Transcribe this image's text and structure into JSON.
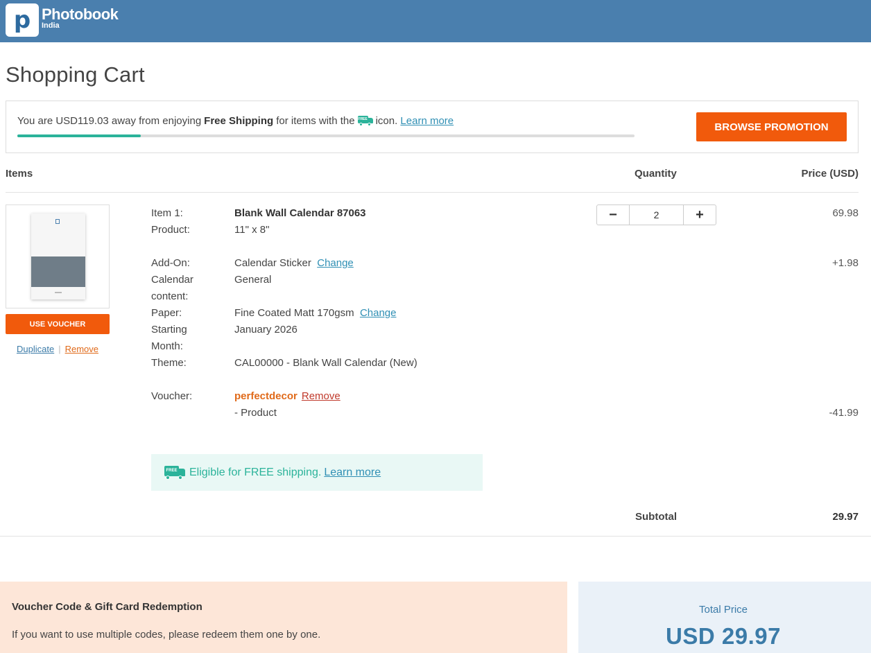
{
  "header": {
    "brand": "Photobook",
    "brand_sub": "India",
    "logo_letter": "p",
    "bg_color": "#4a7fae"
  },
  "page_title": "Shopping Cart",
  "shipping_banner": {
    "prefix": "You are USD119.03 away from enjoying",
    "bold": "Free Shipping",
    "middle": "for items with the",
    "icon_label": "FREE",
    "suffix": "icon.",
    "link": "Learn more",
    "progress_fraction": 0.2,
    "button": "BROWSE PROMOTION"
  },
  "columns": {
    "items": "Items",
    "quantity": "Quantity",
    "price": "Price (USD)"
  },
  "item": {
    "item_label": "Item 1:",
    "item_name": "Blank Wall Calendar 87063",
    "product_label": "Product:",
    "product_value": "11\" x 8\"",
    "addon_label": "Add-On:",
    "addon_value": "Calendar Sticker",
    "addon_change": "Change",
    "content_label_1": "Calendar",
    "content_label_2": "content:",
    "content_value": "General",
    "paper_label": "Paper:",
    "paper_value": "Fine Coated Matt 170gsm",
    "paper_change": "Change",
    "start_label_1": "Starting",
    "start_label_2": "Month:",
    "start_value": "January 2026",
    "theme_label": "Theme:",
    "theme_value": "CAL00000 - Blank Wall Calendar (New)",
    "voucher_label": "Voucher:",
    "voucher_code": "perfectdecor",
    "voucher_remove": "Remove",
    "voucher_note": "- Product",
    "use_voucher": "USE VOUCHER",
    "duplicate": "Duplicate",
    "separator": "|",
    "remove": "Remove",
    "quantity": "2",
    "minus": "−",
    "plus": "+",
    "price": "69.98",
    "addon_price": "+1.98",
    "voucher_price": "-41.99",
    "free_icon_label": "FREE",
    "free_text": "Eligible for FREE shipping.",
    "free_link": "Learn more"
  },
  "subtotal": {
    "label": "Subtotal",
    "value": "29.97"
  },
  "voucher_panel": {
    "title": "Voucher Code & Gift Card Redemption",
    "desc": "If you want to use multiple codes, please redeem them one by one."
  },
  "total_panel": {
    "label": "Total Price",
    "value": "USD 29.97"
  },
  "colors": {
    "accent_orange": "#f15a0c",
    "teal": "#2bb39a",
    "link_blue": "#2f8fb4"
  }
}
